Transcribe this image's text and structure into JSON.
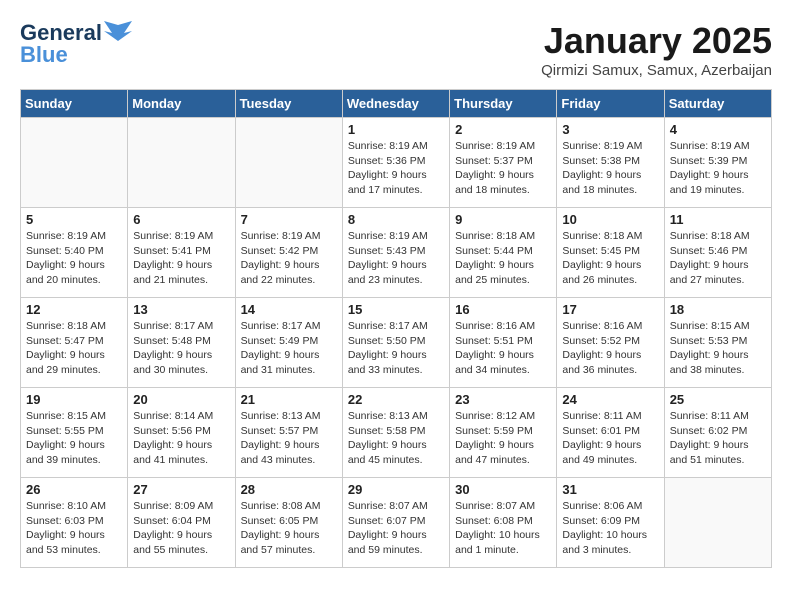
{
  "logo": {
    "general": "General",
    "blue": "Blue"
  },
  "title": "January 2025",
  "subtitle": "Qirmizi Samux, Samux, Azerbaijan",
  "days_of_week": [
    "Sunday",
    "Monday",
    "Tuesday",
    "Wednesday",
    "Thursday",
    "Friday",
    "Saturday"
  ],
  "weeks": [
    [
      {
        "day": "",
        "info": ""
      },
      {
        "day": "",
        "info": ""
      },
      {
        "day": "",
        "info": ""
      },
      {
        "day": "1",
        "info": "Sunrise: 8:19 AM\nSunset: 5:36 PM\nDaylight: 9 hours\nand 17 minutes."
      },
      {
        "day": "2",
        "info": "Sunrise: 8:19 AM\nSunset: 5:37 PM\nDaylight: 9 hours\nand 18 minutes."
      },
      {
        "day": "3",
        "info": "Sunrise: 8:19 AM\nSunset: 5:38 PM\nDaylight: 9 hours\nand 18 minutes."
      },
      {
        "day": "4",
        "info": "Sunrise: 8:19 AM\nSunset: 5:39 PM\nDaylight: 9 hours\nand 19 minutes."
      }
    ],
    [
      {
        "day": "5",
        "info": "Sunrise: 8:19 AM\nSunset: 5:40 PM\nDaylight: 9 hours\nand 20 minutes."
      },
      {
        "day": "6",
        "info": "Sunrise: 8:19 AM\nSunset: 5:41 PM\nDaylight: 9 hours\nand 21 minutes."
      },
      {
        "day": "7",
        "info": "Sunrise: 8:19 AM\nSunset: 5:42 PM\nDaylight: 9 hours\nand 22 minutes."
      },
      {
        "day": "8",
        "info": "Sunrise: 8:19 AM\nSunset: 5:43 PM\nDaylight: 9 hours\nand 23 minutes."
      },
      {
        "day": "9",
        "info": "Sunrise: 8:18 AM\nSunset: 5:44 PM\nDaylight: 9 hours\nand 25 minutes."
      },
      {
        "day": "10",
        "info": "Sunrise: 8:18 AM\nSunset: 5:45 PM\nDaylight: 9 hours\nand 26 minutes."
      },
      {
        "day": "11",
        "info": "Sunrise: 8:18 AM\nSunset: 5:46 PM\nDaylight: 9 hours\nand 27 minutes."
      }
    ],
    [
      {
        "day": "12",
        "info": "Sunrise: 8:18 AM\nSunset: 5:47 PM\nDaylight: 9 hours\nand 29 minutes."
      },
      {
        "day": "13",
        "info": "Sunrise: 8:17 AM\nSunset: 5:48 PM\nDaylight: 9 hours\nand 30 minutes."
      },
      {
        "day": "14",
        "info": "Sunrise: 8:17 AM\nSunset: 5:49 PM\nDaylight: 9 hours\nand 31 minutes."
      },
      {
        "day": "15",
        "info": "Sunrise: 8:17 AM\nSunset: 5:50 PM\nDaylight: 9 hours\nand 33 minutes."
      },
      {
        "day": "16",
        "info": "Sunrise: 8:16 AM\nSunset: 5:51 PM\nDaylight: 9 hours\nand 34 minutes."
      },
      {
        "day": "17",
        "info": "Sunrise: 8:16 AM\nSunset: 5:52 PM\nDaylight: 9 hours\nand 36 minutes."
      },
      {
        "day": "18",
        "info": "Sunrise: 8:15 AM\nSunset: 5:53 PM\nDaylight: 9 hours\nand 38 minutes."
      }
    ],
    [
      {
        "day": "19",
        "info": "Sunrise: 8:15 AM\nSunset: 5:55 PM\nDaylight: 9 hours\nand 39 minutes."
      },
      {
        "day": "20",
        "info": "Sunrise: 8:14 AM\nSunset: 5:56 PM\nDaylight: 9 hours\nand 41 minutes."
      },
      {
        "day": "21",
        "info": "Sunrise: 8:13 AM\nSunset: 5:57 PM\nDaylight: 9 hours\nand 43 minutes."
      },
      {
        "day": "22",
        "info": "Sunrise: 8:13 AM\nSunset: 5:58 PM\nDaylight: 9 hours\nand 45 minutes."
      },
      {
        "day": "23",
        "info": "Sunrise: 8:12 AM\nSunset: 5:59 PM\nDaylight: 9 hours\nand 47 minutes."
      },
      {
        "day": "24",
        "info": "Sunrise: 8:11 AM\nSunset: 6:01 PM\nDaylight: 9 hours\nand 49 minutes."
      },
      {
        "day": "25",
        "info": "Sunrise: 8:11 AM\nSunset: 6:02 PM\nDaylight: 9 hours\nand 51 minutes."
      }
    ],
    [
      {
        "day": "26",
        "info": "Sunrise: 8:10 AM\nSunset: 6:03 PM\nDaylight: 9 hours\nand 53 minutes."
      },
      {
        "day": "27",
        "info": "Sunrise: 8:09 AM\nSunset: 6:04 PM\nDaylight: 9 hours\nand 55 minutes."
      },
      {
        "day": "28",
        "info": "Sunrise: 8:08 AM\nSunset: 6:05 PM\nDaylight: 9 hours\nand 57 minutes."
      },
      {
        "day": "29",
        "info": "Sunrise: 8:07 AM\nSunset: 6:07 PM\nDaylight: 9 hours\nand 59 minutes."
      },
      {
        "day": "30",
        "info": "Sunrise: 8:07 AM\nSunset: 6:08 PM\nDaylight: 10 hours\nand 1 minute."
      },
      {
        "day": "31",
        "info": "Sunrise: 8:06 AM\nSunset: 6:09 PM\nDaylight: 10 hours\nand 3 minutes."
      },
      {
        "day": "",
        "info": ""
      }
    ]
  ]
}
